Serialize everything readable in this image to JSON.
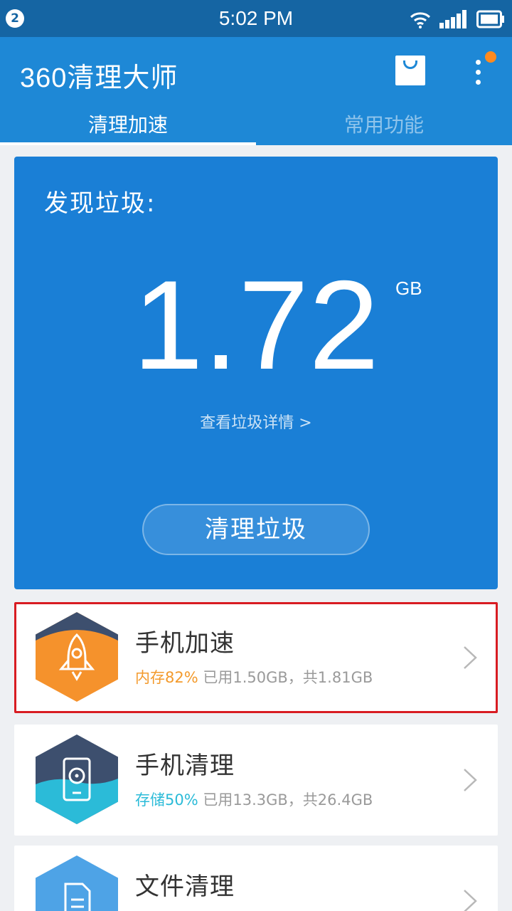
{
  "status_bar": {
    "notification_count": "2",
    "time": "5:02 PM"
  },
  "header": {
    "app_title": "360清理大师",
    "tabs": [
      {
        "label": "清理加速",
        "active": true
      },
      {
        "label": "常用功能",
        "active": false
      }
    ]
  },
  "junk_card": {
    "label": "发现垃圾:",
    "value": "1.72",
    "unit": "GB",
    "detail_link": "查看垃圾详情 >",
    "clean_button": "清理垃圾"
  },
  "features": [
    {
      "title": "手机加速",
      "highlight": "内存82%",
      "detail": "已用1.50GB，共1.81GB",
      "icon": "rocket-icon",
      "color": "#f5922c"
    },
    {
      "title": "手机清理",
      "highlight": "存储50%",
      "detail": "已用13.3GB，共26.4GB",
      "icon": "phone-fan-icon",
      "color": "#2bbbd8"
    },
    {
      "title": "文件清理",
      "highlight": "",
      "detail": "",
      "icon": "document-icon",
      "color": "#4ea3e6"
    }
  ],
  "colors": {
    "status_bar": "#1565a3",
    "header": "#1e88d6",
    "junk_card": "#1a7fd6",
    "accent_orange": "#f39a2c",
    "accent_cyan": "#2bbbd8",
    "selection": "#d81c22"
  }
}
